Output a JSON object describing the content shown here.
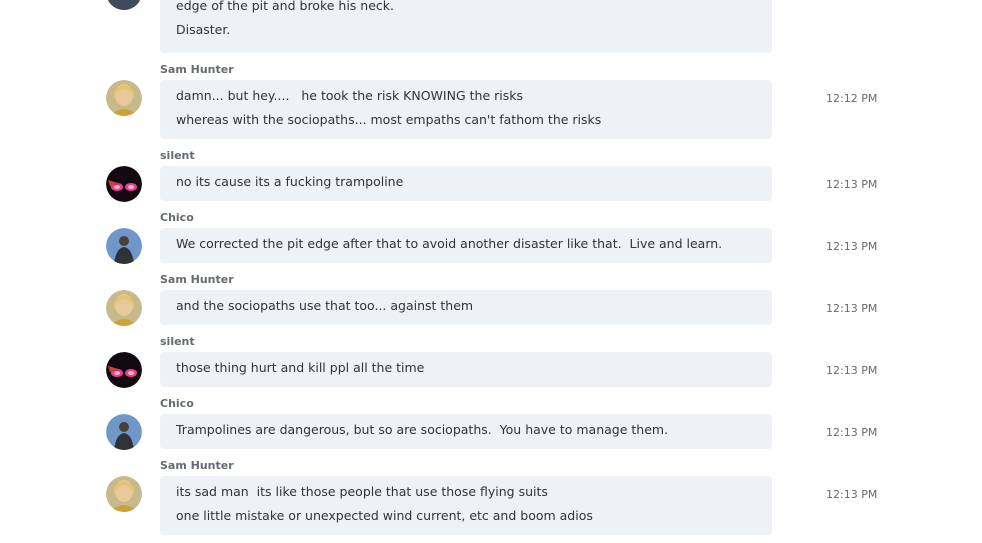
{
  "messages": [
    {
      "sender": "",
      "avatar": "avatar-partial",
      "lines": [
        "edge of the pit and broke his neck.",
        "Disaster."
      ],
      "time": ""
    },
    {
      "sender": "Sam Hunter",
      "avatar": "avatar-sam",
      "lines": [
        "damn... but hey....   he took the risk KNOWING the risks",
        "whereas with the sociopaths... most empaths can't fathom the risks"
      ],
      "time": "12:12 PM"
    },
    {
      "sender": "silent",
      "avatar": "avatar-silent",
      "lines": [
        "no its cause its a fucking trampoline"
      ],
      "time": "12:13 PM"
    },
    {
      "sender": "Chico",
      "avatar": "avatar-chico",
      "lines": [
        "We corrected the pit edge after that to avoid another disaster like that.  Live and learn."
      ],
      "time": "12:13 PM"
    },
    {
      "sender": "Sam Hunter",
      "avatar": "avatar-sam",
      "lines": [
        "and the sociopaths use that too... against them"
      ],
      "time": "12:13 PM"
    },
    {
      "sender": "silent",
      "avatar": "avatar-silent",
      "lines": [
        "those thing hurt and kill ppl all the time"
      ],
      "time": "12:13 PM"
    },
    {
      "sender": "Chico",
      "avatar": "avatar-chico",
      "lines": [
        "Trampolines are dangerous, but so are sociopaths.  You have to manage them."
      ],
      "time": "12:13 PM"
    },
    {
      "sender": "Sam Hunter",
      "avatar": "avatar-sam",
      "lines": [
        "its sad man  its like those people that use those flying suits",
        "one little mistake or unexpected wind current, etc and boom adios"
      ],
      "time": "12:13 PM"
    }
  ]
}
